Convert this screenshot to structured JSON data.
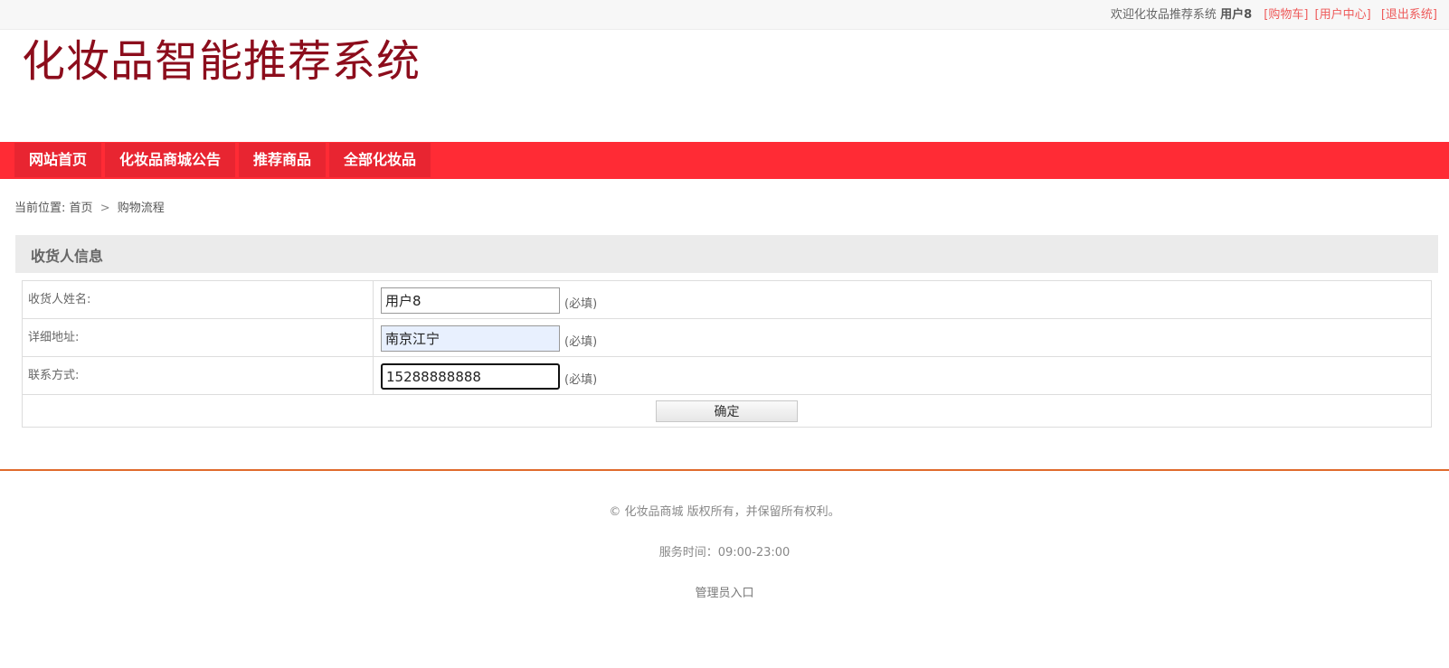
{
  "topbar": {
    "welcome": "欢迎化妆品推荐系统",
    "username": "用户8",
    "links": [
      "[购物车]",
      "[用户中心]",
      "[退出系统]"
    ]
  },
  "site": {
    "logo_text": "化妆品智能推荐系统"
  },
  "nav": {
    "items": [
      "网站首页",
      "化妆品商城公告",
      "推荐商品",
      "全部化妆品"
    ]
  },
  "breadcrumb": {
    "prefix": "当前位置:",
    "home": "首页",
    "separator": ">",
    "current": "购物流程"
  },
  "section": {
    "title": "收货人信息"
  },
  "form": {
    "rows": [
      {
        "label": "收货人姓名:",
        "value": "用户8",
        "note": "(必填)"
      },
      {
        "label": "详细地址:",
        "value": "南京江宁",
        "note": "(必填)"
      },
      {
        "label": "联系方式:",
        "value": "15288888888",
        "note": "(必填)"
      }
    ],
    "submit_label": "确定"
  },
  "footer": {
    "copyright": "© 化妆品商城 版权所有，并保留所有权利。",
    "service_hours": "服务时间：09:00-23:00",
    "admin_link": "管理员入口"
  },
  "colors": {
    "nav_bg": "#ff2b35",
    "nav_item_bg": "#e82531",
    "logo": "#8c0d1c",
    "top_link": "#ee5a5a",
    "footer_line": "#e06a2c"
  }
}
